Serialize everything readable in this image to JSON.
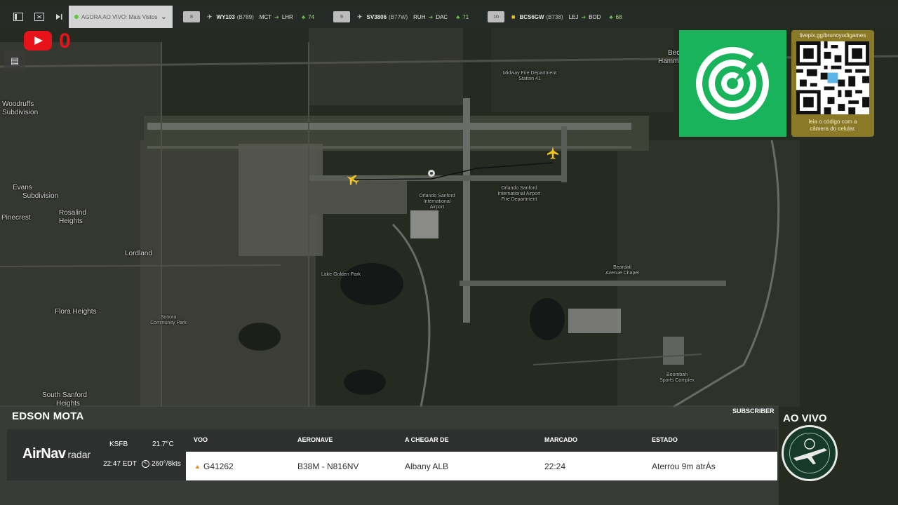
{
  "topbar": {
    "icons": [
      "sidebar-icon",
      "expand-icon",
      "skip-icon"
    ],
    "live_label": "AGORA AO VIVO: Mais Vistos",
    "flights": [
      {
        "num": "8",
        "callsign": "WY103",
        "aircraft": "(B789)",
        "from": "MCT",
        "to": "LHR",
        "signal": "74",
        "icon_color": "#cfcfcf"
      },
      {
        "num": "9",
        "callsign": "SV3806",
        "aircraft": "(B77W)",
        "from": "RUH",
        "to": "DAC",
        "signal": "71",
        "icon_color": "#cfcfcf"
      },
      {
        "num": "10",
        "callsign": "BCS6GW",
        "aircraft": "(B738)",
        "from": "LEJ",
        "to": "BOD",
        "signal": "68",
        "icon_color": "#f3c51c"
      }
    ]
  },
  "youtube": {
    "count": "0",
    "color": "#e8121b"
  },
  "qr": {
    "url": "livepix.gg/brunoyudigames",
    "caption_line1": "leia o código com a",
    "caption_line2": "câmera do celular."
  },
  "map_labels": {
    "woodruffs": "Woodruffs",
    "subdivision1": "Subdivision",
    "evans": "Evans",
    "subdivision2": "Subdivision",
    "rosalind": "Rosalind",
    "heights1": "Heights",
    "pinecrest": "Pinecrest",
    "lordland": "Lordland",
    "flora_heights": "Flora Heights",
    "south_sanford": "South Sanford",
    "heights2": "Heights",
    "bec": "Bec",
    "hamm": "Hamm",
    "midway_fire1": "Midway Fire Department",
    "midway_fire2": "Station 41",
    "airport1": "Orlando Sanford",
    "airport2": "International",
    "airport3": "Airport",
    "airport_fire1": "Orlando Sanford",
    "airport_fire2": "International Airport",
    "airport_fire3": "Fire Department",
    "lake_golden": "Lake Golden Park",
    "sonora": "Sonora",
    "sonora2": "Community Park",
    "beardall": "Beardall",
    "beardall2": "Avenue Chapel",
    "boombah": "Boombah",
    "boombah2": "Sports Complex"
  },
  "bottom": {
    "subscriber": "SUBSCRIBER",
    "name": "EDSON MOTA",
    "airnav_brand": "AirNav",
    "airnav_sub": "radar",
    "airport": "KSFB",
    "temperature": "21.7°C",
    "local_time": "22:47 EDT",
    "wind": "260°/8kts",
    "headers": {
      "flight": "VOO",
      "aircraft": "AERONAVE",
      "from": "A CHEGAR DE",
      "scheduled": "MARCADO",
      "status": "ESTADO"
    },
    "row": {
      "flight": "G41262",
      "aircraft": "B38M - N816NV",
      "from": "Albany ALB",
      "scheduled": "22:24",
      "status": "Aterrou 9m atrÁs"
    }
  },
  "ao_vivo": "AO VIVO",
  "colors": {
    "plane": "#f3c51c",
    "fr_green": "#19b35c",
    "qr_gold": "#8a7a28"
  }
}
